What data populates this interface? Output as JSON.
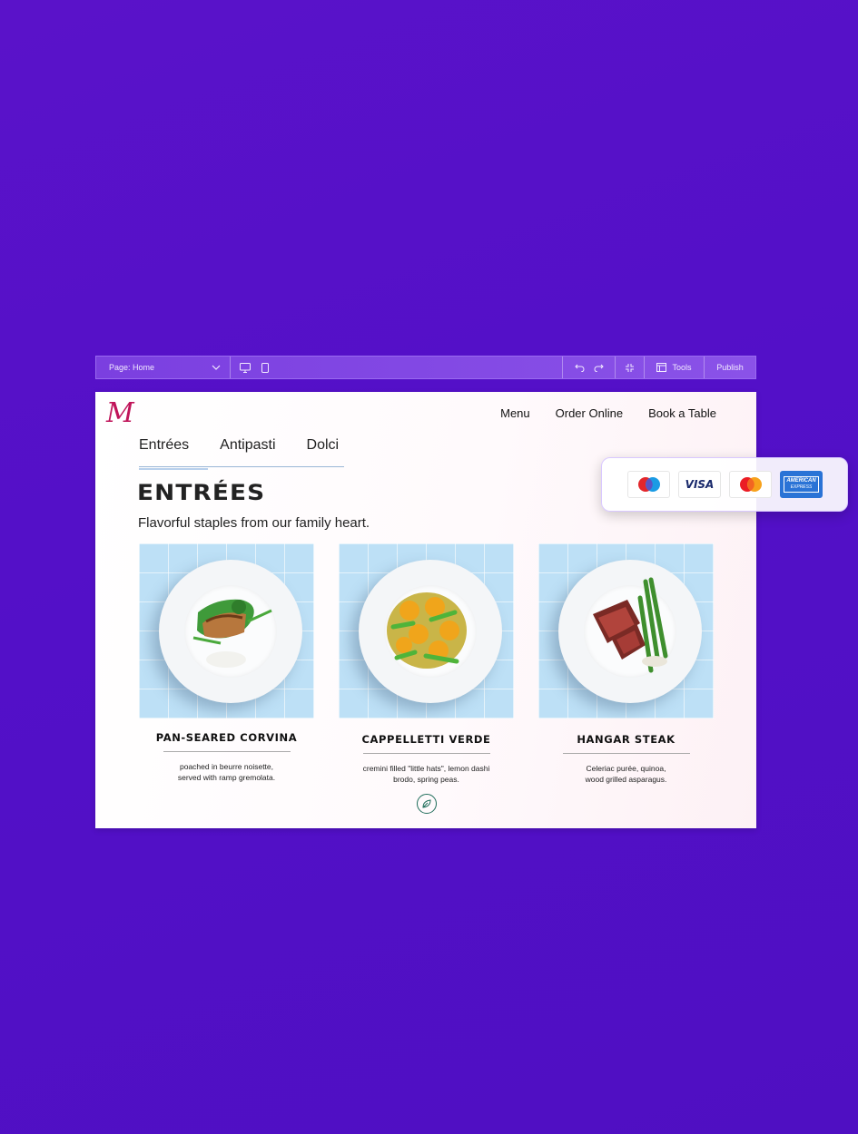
{
  "editor": {
    "page_label": "Page: Home",
    "tools_label": "Tools",
    "publish_label": "Publish"
  },
  "site": {
    "logo": "M",
    "nav": [
      "Menu",
      "Order Online",
      "Book a Table"
    ],
    "tabs": [
      "Entrées",
      "Antipasti",
      "Dolci"
    ],
    "heading": "ENTRÉES",
    "subheading": "Flavorful staples from our family heart.",
    "dishes": [
      {
        "title": "PAN-SEARED CORVINA",
        "desc1": "poached in beurre noisette,",
        "desc2": "served with ramp gremolata."
      },
      {
        "title": "CAPPELLETTI VERDE",
        "desc1": "cremini filled \"little hats\", lemon dashi",
        "desc2": "brodo, spring peas."
      },
      {
        "title": "HANGAR STEAK",
        "desc1": "Celeriac purée, quinoa,",
        "desc2": "wood grilled asparagus."
      }
    ]
  },
  "payments": {
    "visa": "VISA",
    "amex_line1": "AMERICAN",
    "amex_line2": "EXPRESS"
  },
  "colors": {
    "background": "#5510c8",
    "toolbar": "#7b3fe0",
    "logo": "#c0145a",
    "leaf": "#1f6d5a"
  }
}
